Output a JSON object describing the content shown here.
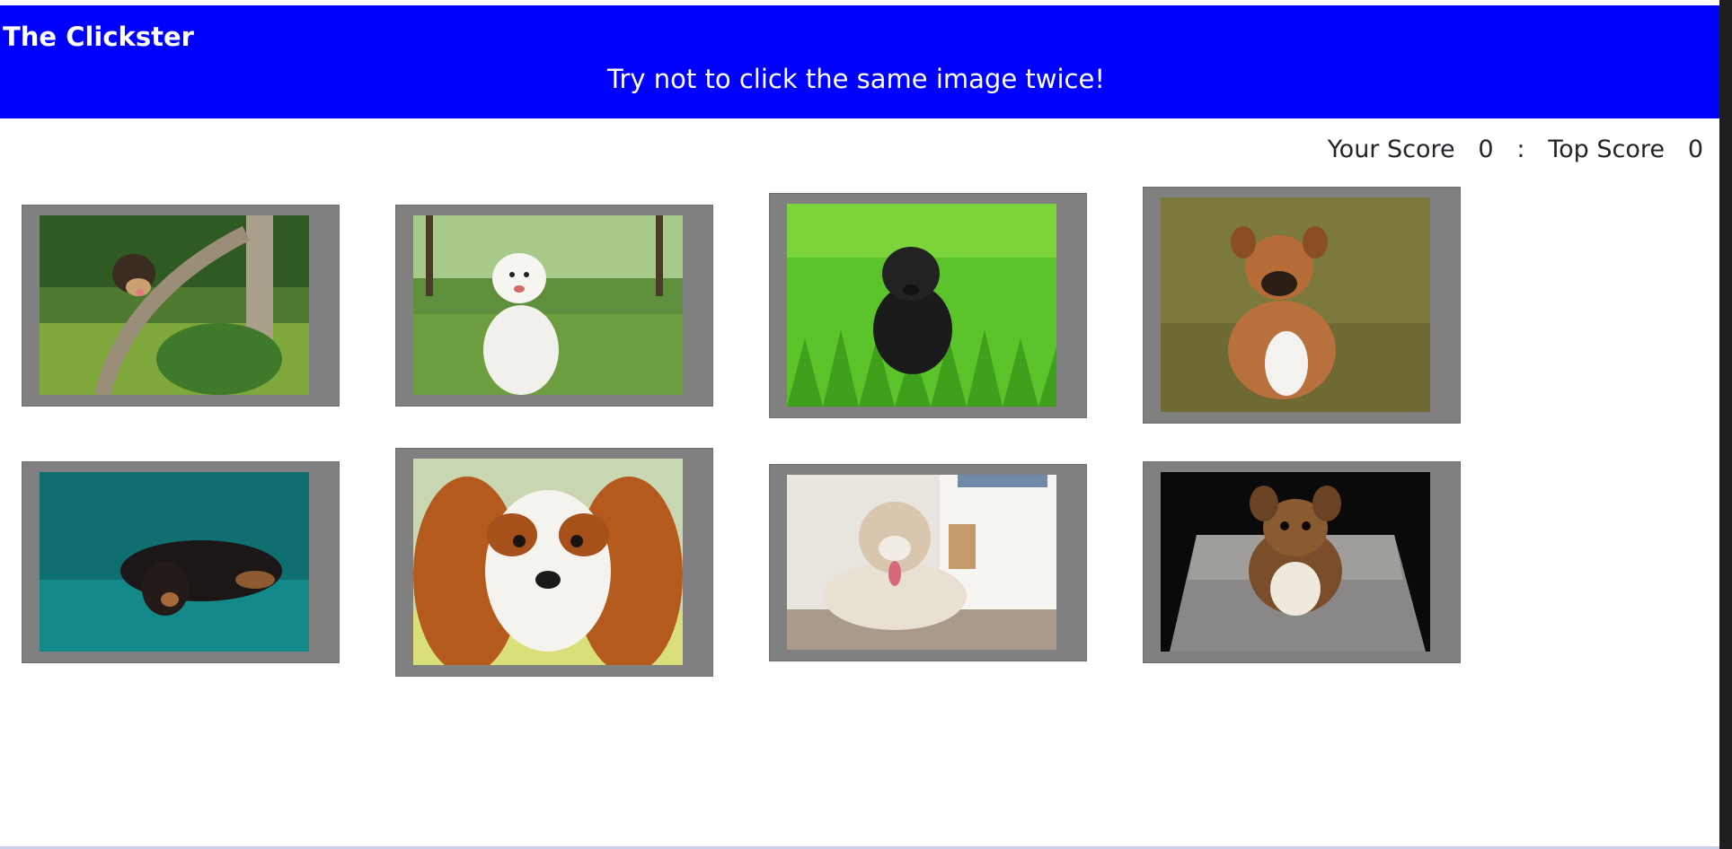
{
  "header": {
    "brand": "The Clickster",
    "subtitle": "Try not to click the same image twice!",
    "background": "#0000ff"
  },
  "score": {
    "label_your": "Your Score",
    "your_score": "0",
    "separator": ":",
    "label_top": "Top Score",
    "top_score": "0"
  },
  "cards": [
    {
      "icon": "yorkie-puppy-image"
    },
    {
      "icon": "white-samoyed-puppy-image"
    },
    {
      "icon": "black-puppy-in-grass-image"
    },
    {
      "icon": "brown-boxer-puppy-image"
    },
    {
      "icon": "black-dachshund-image"
    },
    {
      "icon": "cavalier-spaniel-image"
    },
    {
      "icon": "husky-puppy-image"
    },
    {
      "icon": "chihuahua-image"
    }
  ]
}
